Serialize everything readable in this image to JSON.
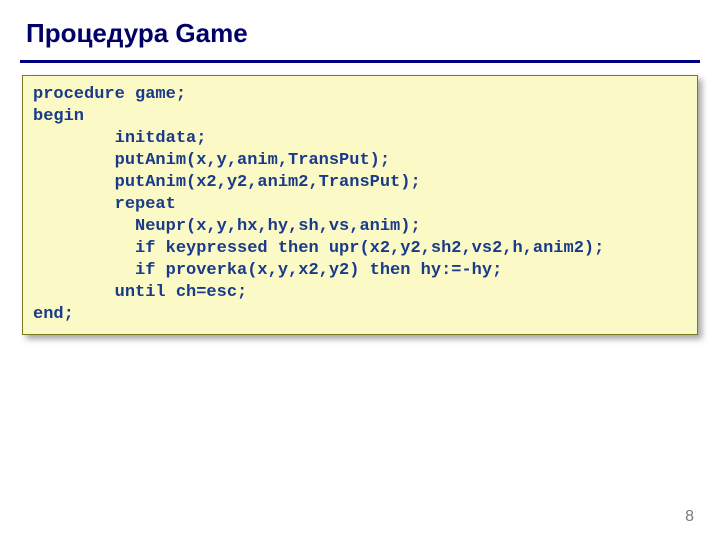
{
  "title": "Процедура Game",
  "code": {
    "l0": "procedure game;",
    "l1": "begin",
    "l2": "        initdata;",
    "l3": "        putAnim(x,y,anim,TransPut);",
    "l4": "        putAnim(x2,y2,anim2,TransPut);",
    "l5": "        repeat",
    "l6": "          Neupr(x,y,hx,hy,sh,vs,anim);",
    "l7": "          if keypressed then upr(x2,y2,sh2,vs2,h,anim2);",
    "l8": "          if proverka(x,y,x2,y2) then hy:=-hy;",
    "l9": "        until ch=esc;",
    "l10": "end;"
  },
  "page_number": "8"
}
